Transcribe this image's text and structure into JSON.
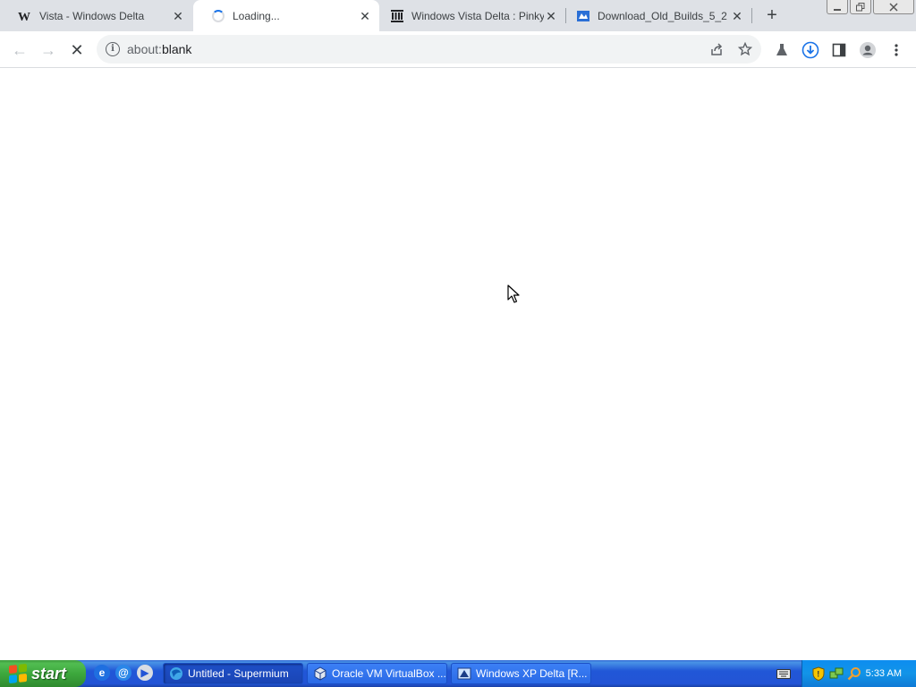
{
  "browser": {
    "tabs": [
      {
        "title": "Vista - Windows Delta",
        "favicon": "wikipedia-w-icon",
        "active": false
      },
      {
        "title": "Loading...",
        "favicon": "loading-spinner-icon",
        "active": true
      },
      {
        "title": "Windows Vista Delta : Pinky :",
        "favicon": "internet-archive-icon",
        "active": false
      },
      {
        "title": "Download_Old_Builds_5_2 -",
        "favicon": "file-download-icon",
        "active": false
      }
    ],
    "new_tab_glyph": "+",
    "close_glyph": "✕"
  },
  "toolbar": {
    "back_glyph": "←",
    "forward_glyph": "→",
    "stop_glyph": "✕",
    "url_scheme": "about:",
    "url_rest": "blank",
    "info_glyph": "i"
  },
  "taskbar": {
    "start_label": "start",
    "tasks": [
      {
        "label": "Untitled - Supermium",
        "icon": "supermium-icon",
        "active": true
      },
      {
        "label": "Oracle VM VirtualBox ...",
        "icon": "virtualbox-icon",
        "active": false
      },
      {
        "label": "Windows XP Delta [R...",
        "icon": "windows-xp-delta-icon",
        "active": false
      }
    ],
    "clock": "5:33 AM"
  },
  "colors": {
    "tabstrip_bg": "#dee1e6",
    "omnibox_bg": "#f1f3f4",
    "taskbar_blue": "#2254d6",
    "start_green": "#3da83d",
    "tray_blue": "#1294e8"
  }
}
